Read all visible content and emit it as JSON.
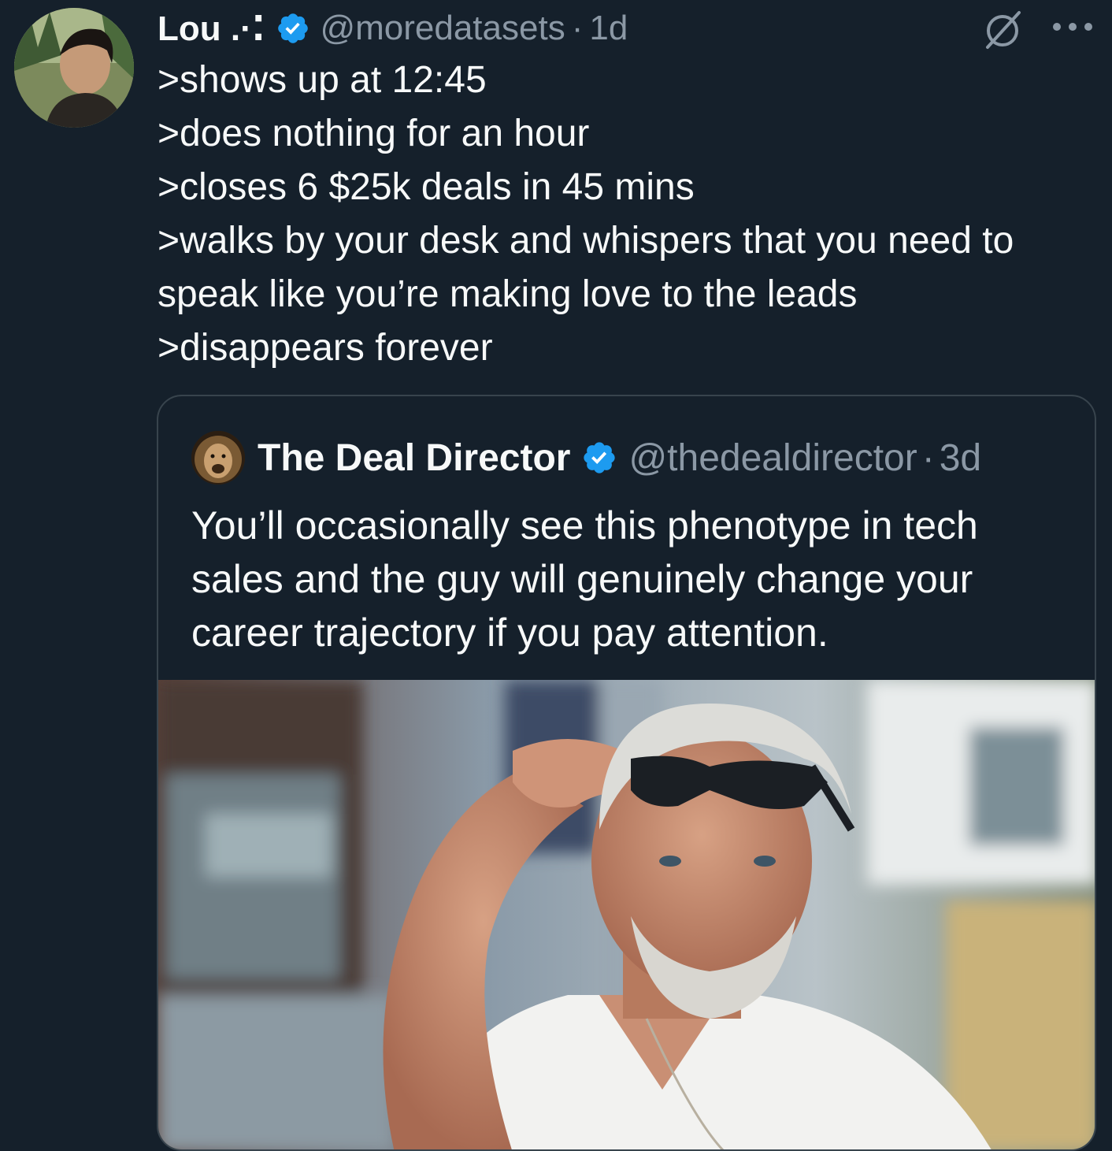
{
  "tweet": {
    "author": {
      "display_name": "Lou .·⁚",
      "handle": "@moredatasets",
      "verified": true
    },
    "separator": "·",
    "time": "1d",
    "lines": [
      ">shows up at 12:45",
      ">does nothing for an hour",
      ">closes 6 $25k deals in 45 mins",
      ">walks by your desk and whispers that you need to",
      "speak like you’re making love to the leads",
      ">disappears forever"
    ],
    "icons": {
      "grok": "grok-icon",
      "more": "more-icon",
      "verified": "verified-badge-icon"
    }
  },
  "quote": {
    "author": {
      "display_name": "The Deal Director",
      "handle": "@thedealdirector",
      "verified": true
    },
    "separator": "·",
    "time": "3d",
    "text_lines": [
      "You’ll occasionally see this phenotype in tech",
      "sales and the guy will genuinely change your",
      "career trajectory if you pay attention."
    ]
  },
  "colors": {
    "background": "#15202b",
    "primary_text": "#f7f9f9",
    "secondary_text": "#8b98a5",
    "verified_blue": "#1d9bf0",
    "card_border": "#38444d"
  }
}
